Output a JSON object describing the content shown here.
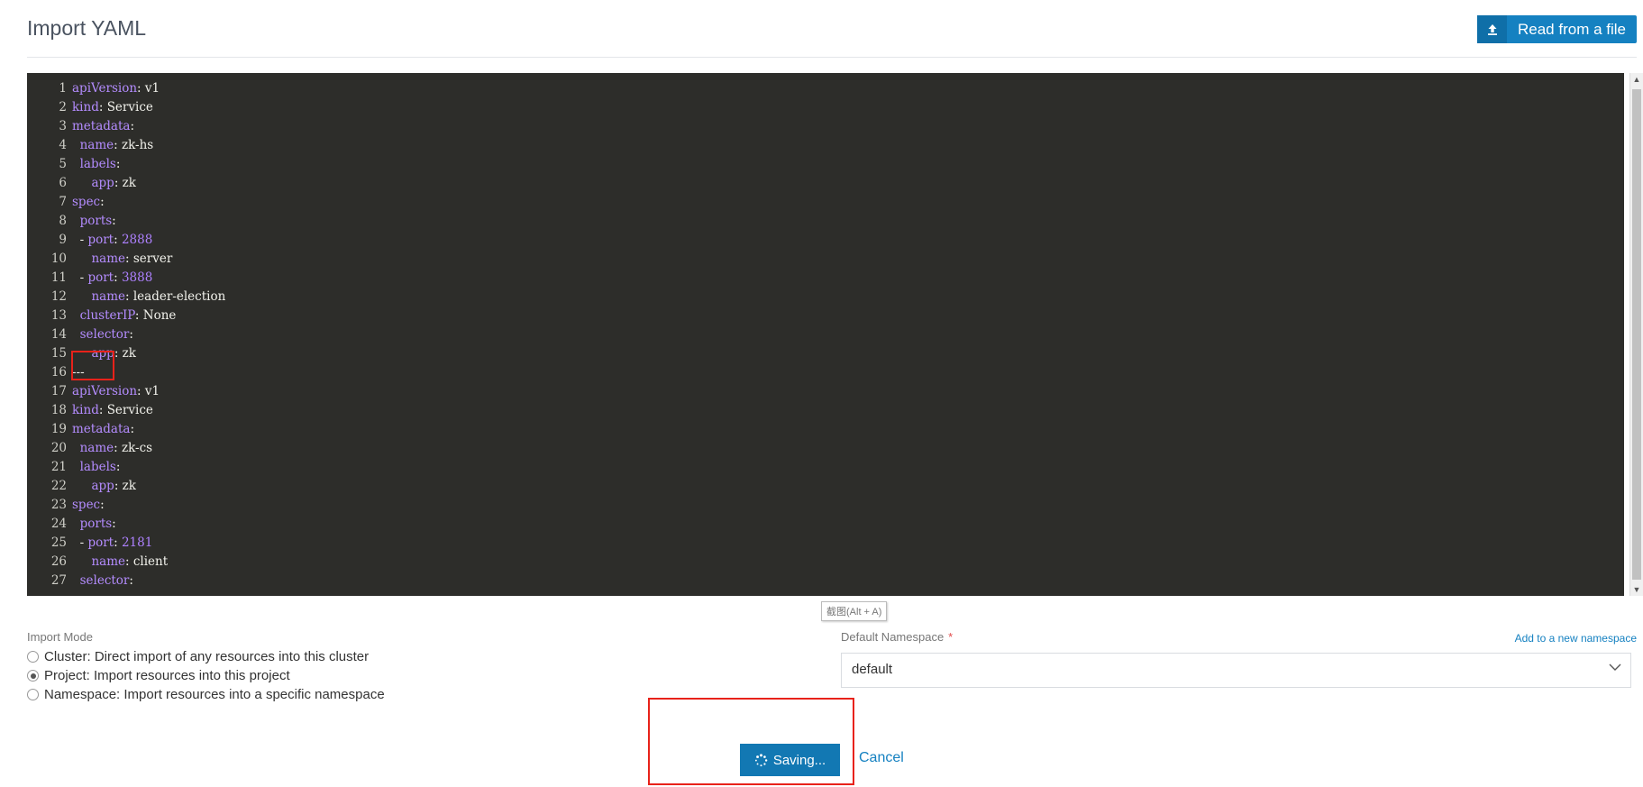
{
  "page": {
    "title": "Import YAML"
  },
  "toolbar": {
    "read_file_label": "Read from a file",
    "upload_icon": "upload-icon"
  },
  "editor": {
    "lines": [
      {
        "n": "1",
        "indent": "",
        "key": "apiVersion",
        "sep": ": ",
        "value": "v1",
        "value_kind": "plain"
      },
      {
        "n": "2",
        "indent": "",
        "key": "kind",
        "sep": ": ",
        "value": "Service",
        "value_kind": "plain"
      },
      {
        "n": "3",
        "indent": "",
        "key": "metadata",
        "sep": ":",
        "value": "",
        "value_kind": "plain"
      },
      {
        "n": "4",
        "indent": "  ",
        "key": "name",
        "sep": ": ",
        "value": "zk-hs",
        "value_kind": "plain"
      },
      {
        "n": "5",
        "indent": "  ",
        "key": "labels",
        "sep": ":",
        "value": "",
        "value_kind": "plain"
      },
      {
        "n": "6",
        "indent": "     ",
        "key": "app",
        "sep": ": ",
        "value": "zk",
        "value_kind": "plain"
      },
      {
        "n": "7",
        "indent": "",
        "key": "spec",
        "sep": ":",
        "value": "",
        "value_kind": "plain"
      },
      {
        "n": "8",
        "indent": "  ",
        "key": "ports",
        "sep": ":",
        "value": "",
        "value_kind": "plain"
      },
      {
        "n": "9",
        "indent": "  - ",
        "key": "port",
        "sep": ": ",
        "value": "2888",
        "value_kind": "num"
      },
      {
        "n": "10",
        "indent": "     ",
        "key": "name",
        "sep": ": ",
        "value": "server",
        "value_kind": "plain"
      },
      {
        "n": "11",
        "indent": "  - ",
        "key": "port",
        "sep": ": ",
        "value": "3888",
        "value_kind": "num"
      },
      {
        "n": "12",
        "indent": "     ",
        "key": "name",
        "sep": ": ",
        "value": "leader-election",
        "value_kind": "plain"
      },
      {
        "n": "13",
        "indent": "  ",
        "key": "clusterIP",
        "sep": ": ",
        "value": "None",
        "value_kind": "plain"
      },
      {
        "n": "14",
        "indent": "  ",
        "key": "selector",
        "sep": ":",
        "value": "",
        "value_kind": "plain"
      },
      {
        "n": "15",
        "indent": "     ",
        "key": "app",
        "sep": ": ",
        "value": "zk",
        "value_kind": "plain"
      },
      {
        "n": "16",
        "indent": "",
        "key": "",
        "sep": "",
        "value": "---",
        "value_kind": "separator"
      },
      {
        "n": "17",
        "indent": "",
        "key": "apiVersion",
        "sep": ": ",
        "value": "v1",
        "value_kind": "plain"
      },
      {
        "n": "18",
        "indent": "",
        "key": "kind",
        "sep": ": ",
        "value": "Service",
        "value_kind": "plain"
      },
      {
        "n": "19",
        "indent": "",
        "key": "metadata",
        "sep": ":",
        "value": "",
        "value_kind": "plain"
      },
      {
        "n": "20",
        "indent": "  ",
        "key": "name",
        "sep": ": ",
        "value": "zk-cs",
        "value_kind": "plain"
      },
      {
        "n": "21",
        "indent": "  ",
        "key": "labels",
        "sep": ":",
        "value": "",
        "value_kind": "plain"
      },
      {
        "n": "22",
        "indent": "     ",
        "key": "app",
        "sep": ": ",
        "value": "zk",
        "value_kind": "plain"
      },
      {
        "n": "23",
        "indent": "",
        "key": "spec",
        "sep": ":",
        "value": "",
        "value_kind": "plain"
      },
      {
        "n": "24",
        "indent": "  ",
        "key": "ports",
        "sep": ":",
        "value": "",
        "value_kind": "plain"
      },
      {
        "n": "25",
        "indent": "  - ",
        "key": "port",
        "sep": ": ",
        "value": "2181",
        "value_kind": "num"
      },
      {
        "n": "26",
        "indent": "     ",
        "key": "name",
        "sep": ": ",
        "value": "client",
        "value_kind": "plain"
      },
      {
        "n": "27",
        "indent": "  ",
        "key": "selector",
        "sep": ":",
        "value": "",
        "value_kind": "plain"
      }
    ]
  },
  "tooltip": {
    "text": "截图(Alt + A)"
  },
  "import_mode": {
    "label": "Import Mode",
    "options": [
      {
        "label": "Cluster: Direct import of any resources into this cluster",
        "selected": false
      },
      {
        "label": "Project: Import resources into this project",
        "selected": true
      },
      {
        "label": "Namespace: Import resources into a specific namespace",
        "selected": false
      }
    ]
  },
  "namespace": {
    "label": "Default Namespace",
    "required_mark": "*",
    "add_link": "Add to a new namespace",
    "value": "default"
  },
  "actions": {
    "saving_label": "Saving...",
    "cancel_label": "Cancel"
  },
  "colors": {
    "accent": "#1581c1",
    "editor_bg": "#2d2d2a",
    "highlight_box": "#e8221a"
  }
}
